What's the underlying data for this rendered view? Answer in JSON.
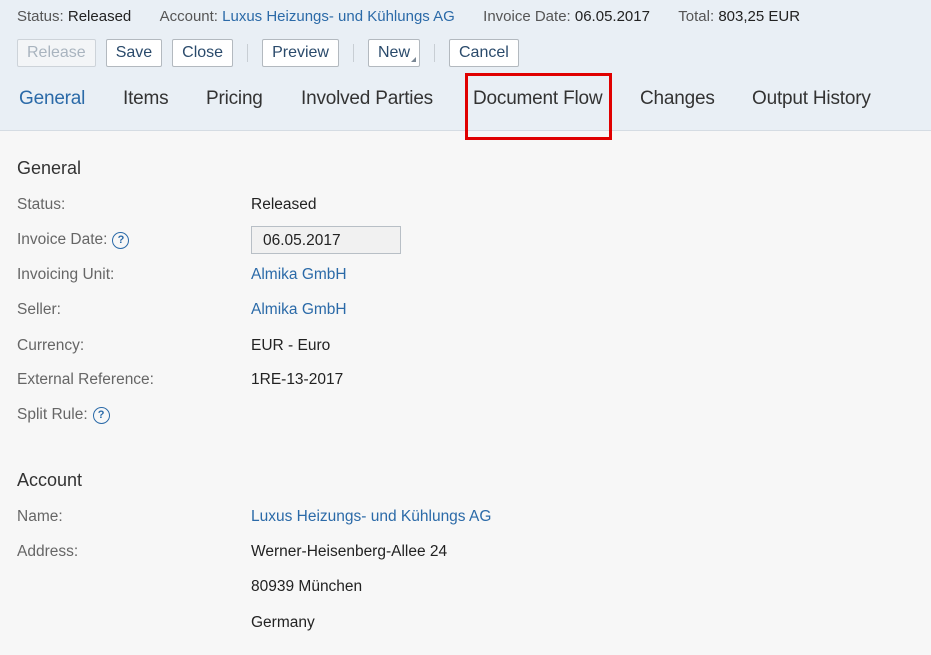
{
  "summary": {
    "status_label": "Status:",
    "status_value": "Released",
    "account_label": "Account:",
    "account_value": "Luxus Heizungs- und Kühlungs AG",
    "invoice_date_label": "Invoice Date:",
    "invoice_date_value": "06.05.2017",
    "total_label": "Total:",
    "total_value": "803,25 EUR"
  },
  "toolbar": {
    "release": "Release",
    "save": "Save",
    "close": "Close",
    "preview": "Preview",
    "new": "New",
    "cancel": "Cancel"
  },
  "tabs": [
    "General",
    "Items",
    "Pricing",
    "Involved Parties",
    "Document Flow",
    "Changes",
    "Output History"
  ],
  "general": {
    "title": "General",
    "status_label": "Status:",
    "status_value": "Released",
    "invoice_date_label": "Invoice Date:",
    "invoice_date_value": "06.05.2017",
    "invoicing_unit_label": "Invoicing Unit:",
    "invoicing_unit_value": "Almika GmbH",
    "seller_label": "Seller:",
    "seller_value": "Almika GmbH",
    "currency_label": "Currency:",
    "currency_value": "EUR - Euro",
    "external_ref_label": "External Reference:",
    "external_ref_value": "1RE-13-2017",
    "split_rule_label": "Split Rule:"
  },
  "account": {
    "title": "Account",
    "name_label": "Name:",
    "name_value": "Luxus Heizungs- und Kühlungs AG",
    "address_label": "Address:",
    "address_line1": "Werner-Heisenberg-Allee 24",
    "address_line2": "80939 München",
    "address_line3": "Germany"
  },
  "icons": {
    "help": "?"
  },
  "colors": {
    "link": "#2b6aa8",
    "highlight": "#e00000",
    "header_bg": "#e9eff5"
  }
}
